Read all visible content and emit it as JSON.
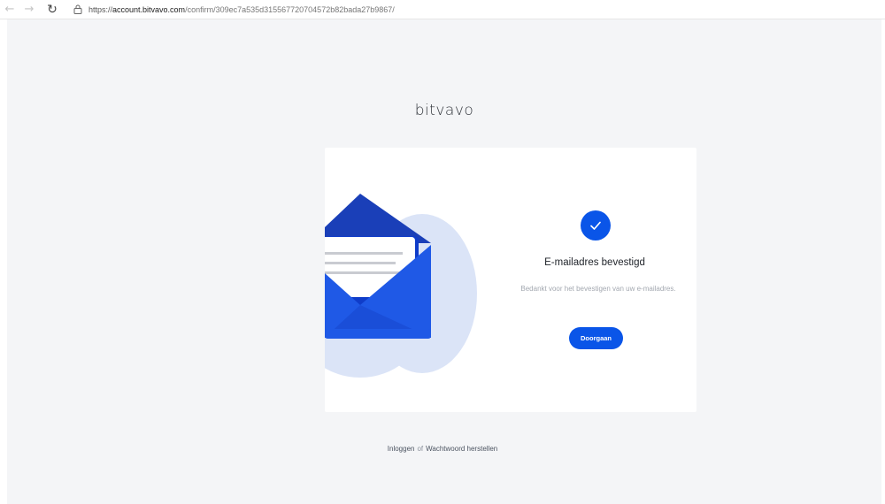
{
  "browser": {
    "back_icon": "back-arrow-icon",
    "forward_icon": "forward-arrow-icon",
    "reload_icon": "reload-icon",
    "lock_icon": "lock-icon",
    "url_scheme": "https://",
    "url_host": "account.bitvavo.com",
    "url_path": "/confirm/309ec7a535d315567720704572b82bada27b9867/"
  },
  "brand": {
    "logo_text": "bitvavo"
  },
  "card": {
    "title": "E-mailadres bevestigd",
    "description": "Bedankt voor het bevestigen van uw e-mailadres.",
    "button_label": "Doorgaan",
    "check_icon": "check-circle-icon",
    "illustration": "envelope-illustration"
  },
  "footer": {
    "login_link": "Inloggen",
    "separator": "of",
    "reset_link": "Wachtwoord herstellen"
  },
  "colors": {
    "accent": "#0a55e8",
    "background": "#f4f5f7",
    "card": "#ffffff"
  }
}
